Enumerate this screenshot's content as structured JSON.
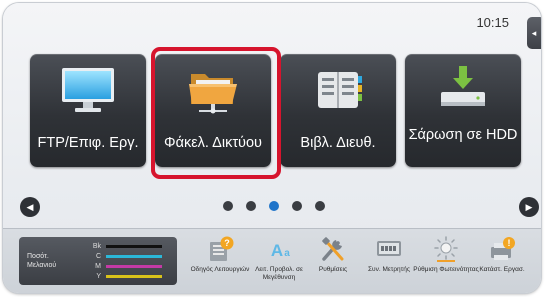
{
  "clock": "10:15",
  "side_tab_icon": "◂",
  "tiles": [
    {
      "label": "FTP/Επιφ. Εργ.",
      "icon": "monitor-icon"
    },
    {
      "label": "Φάκελ. Δικτύου",
      "icon": "network-folder-icon",
      "selected": true
    },
    {
      "label": "Βιβλ. Διευθ.",
      "icon": "address-book-icon"
    },
    {
      "label": "Σάρωση σε HDD",
      "icon": "scan-to-hdd-icon"
    }
  ],
  "nav": {
    "prev": "◀",
    "next": "▶",
    "pages": 5,
    "current_page": 3
  },
  "toner": {
    "label_line1": "Ποσότ.",
    "label_line2": "Μελανιού",
    "colors": [
      {
        "code": "Bk",
        "color": "#111111",
        "level": 0.85
      },
      {
        "code": "C",
        "color": "#2bb8d9",
        "level": 0.85
      },
      {
        "code": "M",
        "color": "#c43aa6",
        "level": 0.85
      },
      {
        "code": "Y",
        "color": "#d8c21a",
        "level": 0.85
      }
    ]
  },
  "tools": [
    {
      "label": "Οδηγός Λειτουργιών",
      "icon": "operation-guide-icon"
    },
    {
      "label": "Λειτ. Προβολ. σε Μεγέθυνση",
      "icon": "enlarge-display-icon"
    },
    {
      "label": "Ρυθμίσεις",
      "icon": "settings-tools-icon"
    },
    {
      "label": "Συν. Μετρητής",
      "icon": "total-count-icon"
    },
    {
      "label": "Ρύθμιση Φωτεινότητας",
      "icon": "brightness-icon"
    },
    {
      "label": "Κατάστ. Εργασ.",
      "icon": "job-status-icon"
    }
  ],
  "highlight_color": "#d6142d",
  "accent_color": "#1f74c9"
}
